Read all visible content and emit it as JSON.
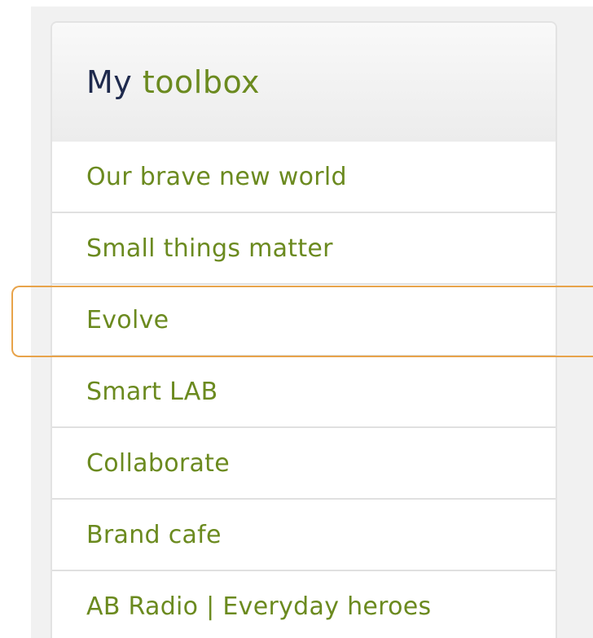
{
  "toolbox": {
    "title_prefix": "My",
    "title_accent": "toolbox",
    "items": [
      {
        "label": "Our brave new world"
      },
      {
        "label": "Small things matter"
      },
      {
        "label": "Evolve"
      },
      {
        "label": "Smart LAB"
      },
      {
        "label": "Collaborate"
      },
      {
        "label": "Brand cafe"
      },
      {
        "label": "AB Radio | Everyday heroes"
      }
    ],
    "highlighted_item": "Evolve"
  },
  "colors": {
    "title": "#1f2a4d",
    "link": "#6b8a1f",
    "highlight": "#e8a34a",
    "divider": "#e0e0e0",
    "background": "#f1f1f1"
  }
}
